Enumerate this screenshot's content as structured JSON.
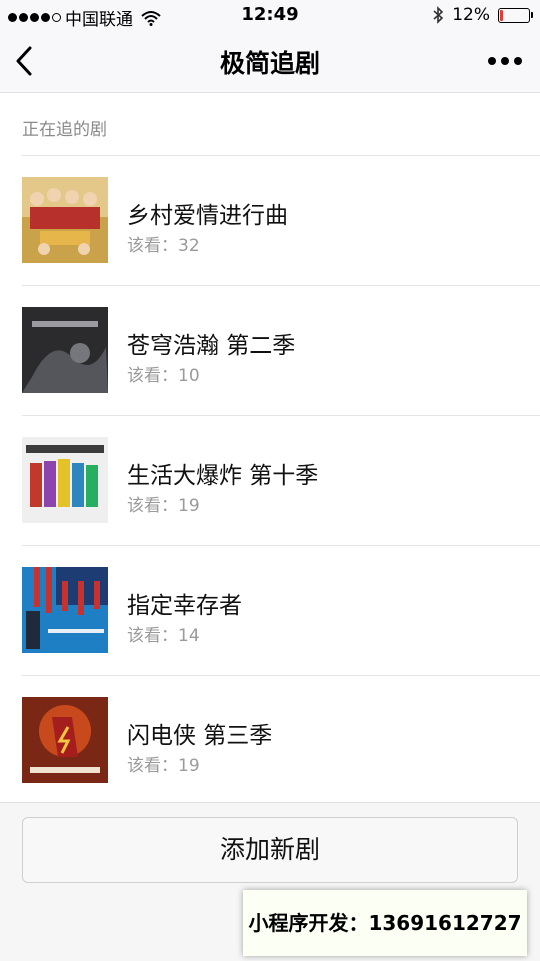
{
  "status_bar": {
    "carrier": "中国联通",
    "time": "12:49",
    "battery": "12%",
    "battery_level": 0.12,
    "signal_bars": 4,
    "icons": [
      "wifi-icon",
      "bluetooth-icon",
      "battery-icon"
    ]
  },
  "navbar": {
    "title": "极简追剧",
    "back_icon": "chevron-left-icon",
    "more_icon": "more-dots-icon"
  },
  "section": {
    "title": "正在追的剧"
  },
  "shows": [
    {
      "name": "乡村爱情进行曲",
      "count": "该看：32"
    },
    {
      "name": "苍穹浩瀚 第二季",
      "count": "该看：10"
    },
    {
      "name": "生活大爆炸 第十季",
      "count": "该看：19"
    },
    {
      "name": "指定幸存者",
      "count": "该看：14"
    },
    {
      "name": "闪电侠 第三季",
      "count": "该看：19"
    }
  ],
  "add_button": {
    "label": "添加新剧"
  },
  "watermark": {
    "text": "小程序开发：13691612727"
  },
  "colors": {
    "accent_battery": "#e53935",
    "secondary_text": "#9a9a9a"
  }
}
